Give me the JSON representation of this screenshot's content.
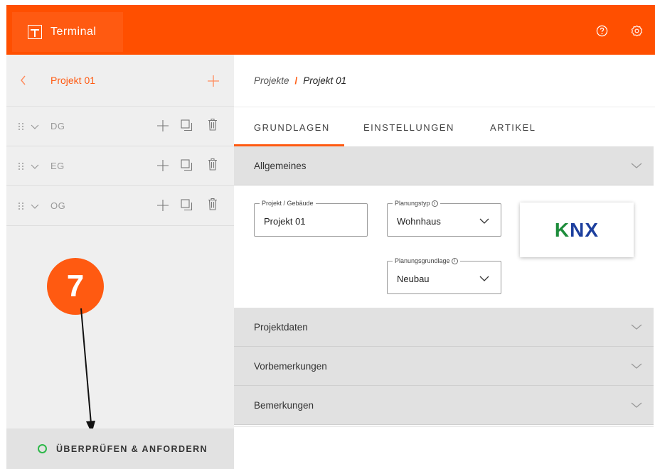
{
  "app": {
    "name": "Terminal"
  },
  "sidebar": {
    "project_title": "Projekt 01",
    "floors": [
      {
        "name": "DG"
      },
      {
        "name": "EG"
      },
      {
        "name": "OG"
      }
    ],
    "footer_label": "ÜBERPRÜFEN & ANFORDERN"
  },
  "callout": {
    "number": "7"
  },
  "breadcrumb": {
    "parent": "Projekte",
    "separator": "/",
    "current": "Projekt 01"
  },
  "tabs": [
    {
      "label": "GRUNDLAGEN",
      "active": true
    },
    {
      "label": "EINSTELLUNGEN",
      "active": false
    },
    {
      "label": "ARTIKEL",
      "active": false
    }
  ],
  "sections": [
    {
      "title": "Allgemeines",
      "expanded": true
    },
    {
      "title": "Projektdaten",
      "expanded": false
    },
    {
      "title": "Vorbemerkungen",
      "expanded": false
    },
    {
      "title": "Bemerkungen",
      "expanded": false
    }
  ],
  "fields": {
    "project": {
      "label": "Projekt / Gebäude",
      "value": "Projekt 01"
    },
    "planning_type": {
      "label": "Planungstyp",
      "value": "Wohnhaus"
    },
    "planning_basis": {
      "label": "Planungsgrundlage",
      "value": "Neubau"
    }
  },
  "logo": {
    "text_k": "K",
    "text_nx": "NX"
  },
  "colors": {
    "accent": "#ff4f00",
    "status_ok": "#2eb84a",
    "knx_green": "#1d8c3b",
    "knx_blue": "#1d3f9e"
  }
}
